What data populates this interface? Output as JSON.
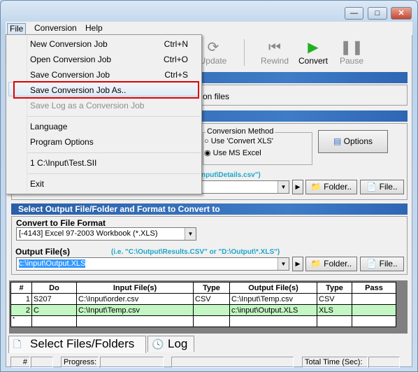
{
  "window": {
    "controls": [
      "minimize",
      "maximize",
      "close"
    ]
  },
  "menubar": {
    "items": [
      "File",
      "Conversion",
      "Help"
    ]
  },
  "file_menu": {
    "items": [
      {
        "label": "New Conversion Job",
        "shortcut": "Ctrl+N"
      },
      {
        "label": "Open Conversion Job",
        "shortcut": "Ctrl+O"
      },
      {
        "label": "Save Conversion Job",
        "shortcut": "Ctrl+S"
      },
      {
        "label": "Save Conversion Job As..",
        "shortcut": "",
        "highlighted": true
      },
      {
        "label": "Save Log as a Conversion Job",
        "shortcut": "",
        "disabled": true
      },
      {
        "label": "Language"
      },
      {
        "label": "Program Options"
      },
      {
        "label": "1 C:\\Input\\Test.SII"
      },
      {
        "label": "Exit"
      }
    ],
    "highlight_color": "#e00000"
  },
  "toolbar": {
    "update": "Update",
    "rewind": "Rewind",
    "convert": "Convert",
    "pause": "Pause"
  },
  "input_section": {
    "partial_text": "on files",
    "hint_partial": "nput\\Details.csv\")",
    "conversion_method": {
      "title": "Conversion Method",
      "options": [
        "Use 'Convert XLS'",
        "Use MS Excel"
      ],
      "selected": 1
    },
    "options_button": "Options",
    "folder_button": "Folder..",
    "file_button": "File.."
  },
  "output_section": {
    "title": "Select Output File/Folder and Format to Convert to",
    "format_label": "Convert to File Format",
    "format_value": "[-4143] Excel 97-2003 Workbook (*.XLS)",
    "output_label": "Output File(s)",
    "output_hint": "(i.e. \"C:\\Output\\Results.CSV\" or \"D:\\Output\\*.XLS\")",
    "output_value": "c:\\input\\Output.XLS",
    "folder_button": "Folder..",
    "file_button": "File.."
  },
  "grid": {
    "headers": [
      "#",
      "Do",
      "Input File(s)",
      "Type",
      "Output File(s)",
      "Type",
      "Pass"
    ],
    "rows": [
      [
        "1",
        "S207",
        "C:\\Input\\order.csv",
        "CSV",
        "C:\\Input\\Temp.csv",
        "CSV",
        ""
      ],
      [
        "2",
        "C",
        "C:\\Input\\Temp.csv",
        "",
        "c:\\input\\Output.XLS",
        "XLS",
        ""
      ],
      [
        "*",
        "",
        "",
        "",
        "",
        "",
        ""
      ]
    ]
  },
  "tabs": {
    "select": "Select Files/Folders",
    "log": "Log"
  },
  "statusbar": {
    "hash": "#",
    "progress": "Progress:",
    "total_time": "Total Time (Sec):"
  }
}
